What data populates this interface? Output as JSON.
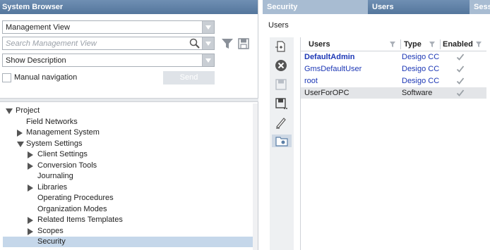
{
  "left_panel": {
    "title": "System Browser",
    "view_combo": {
      "value": "Management View"
    },
    "search": {
      "placeholder": "Search Management View"
    },
    "desc_combo": {
      "value": "Show Description"
    },
    "manual_nav_label": "Manual navigation",
    "manual_nav_checked": false,
    "send_label": "Send",
    "tree": [
      {
        "label": "Project",
        "level": 0,
        "toggle": "expanded"
      },
      {
        "label": "Field Networks",
        "level": 1,
        "toggle": "none"
      },
      {
        "label": "Management System",
        "level": 1,
        "toggle": "collapsed"
      },
      {
        "label": "System Settings",
        "level": 1,
        "toggle": "expanded"
      },
      {
        "label": "Client Settings",
        "level": 2,
        "toggle": "collapsed"
      },
      {
        "label": "Conversion Tools",
        "level": 2,
        "toggle": "collapsed"
      },
      {
        "label": "Journaling",
        "level": 2,
        "toggle": "none"
      },
      {
        "label": "Libraries",
        "level": 2,
        "toggle": "collapsed"
      },
      {
        "label": "Operating Procedures",
        "level": 2,
        "toggle": "none"
      },
      {
        "label": "Organization Modes",
        "level": 2,
        "toggle": "none"
      },
      {
        "label": "Related Items Templates",
        "level": 2,
        "toggle": "collapsed"
      },
      {
        "label": "Scopes",
        "level": 2,
        "toggle": "collapsed"
      },
      {
        "label": "Security",
        "level": 2,
        "toggle": "none",
        "selected": true
      }
    ]
  },
  "right_panel": {
    "tabs": [
      {
        "label": "Security",
        "active": false
      },
      {
        "label": "Users",
        "active": true
      },
      {
        "label": "Sess",
        "active": false
      }
    ],
    "section_title": "Users",
    "toolbar_icons": [
      "add-user-icon",
      "delete-icon",
      "save-icon",
      "save-as-icon",
      "edit-icon",
      "folder-users-icon"
    ],
    "grid": {
      "headers": [
        "Users",
        "Type",
        "Enabled"
      ],
      "rows": [
        {
          "user": "DefaultAdmin",
          "type": "Desigo CC",
          "enabled": true,
          "bold": true,
          "blue": true
        },
        {
          "user": "GmsDefaultUser",
          "type": "Desigo CC",
          "enabled": true,
          "bold": false,
          "blue": true
        },
        {
          "user": "root",
          "type": "Desigo CC",
          "enabled": true,
          "bold": false,
          "blue": true
        },
        {
          "user": "UserForOPC",
          "type": "Software",
          "enabled": true,
          "bold": false,
          "blue": false,
          "selected": true
        }
      ]
    }
  }
}
